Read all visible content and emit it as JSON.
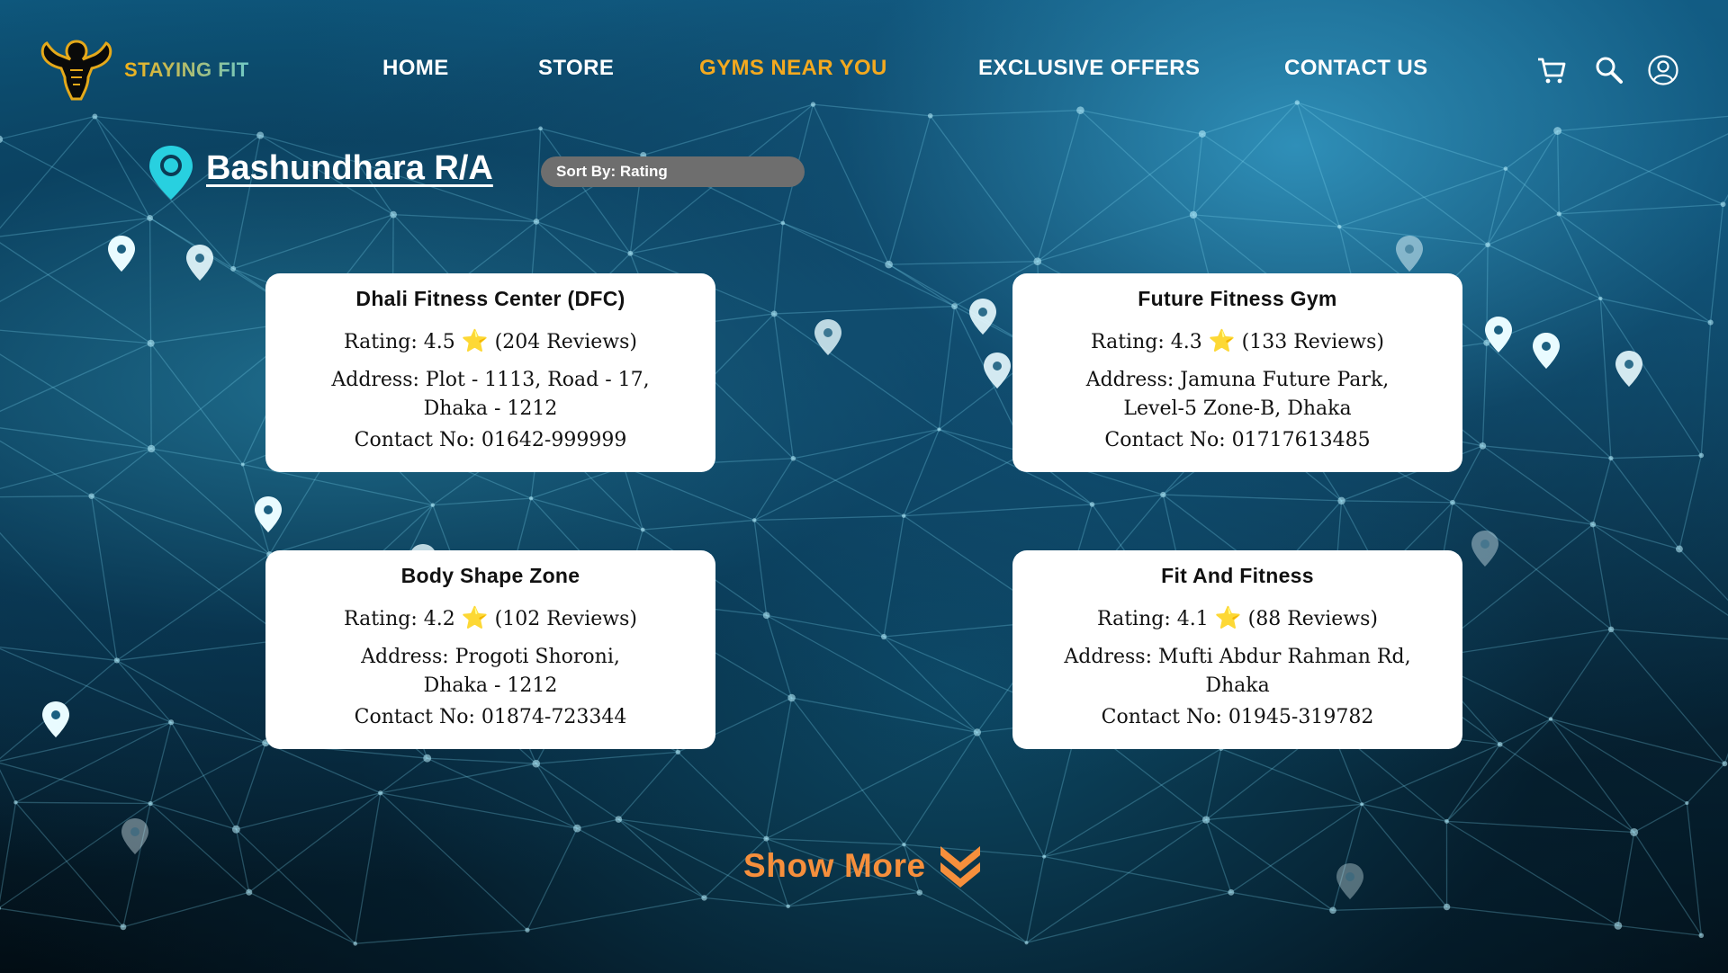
{
  "brand": {
    "name": "STAYING FIT"
  },
  "nav": {
    "items": [
      {
        "label": "HOME",
        "active": false
      },
      {
        "label": "STORE",
        "active": false
      },
      {
        "label": "GYMS NEAR YOU",
        "active": true
      },
      {
        "label": "EXCLUSIVE OFFERS",
        "active": false
      },
      {
        "label": "CONTACT US",
        "active": false
      }
    ],
    "icons": [
      "cart-icon",
      "search-icon",
      "user-icon"
    ]
  },
  "location": {
    "name": "Bashundhara R/A",
    "icon": "map-pin-icon"
  },
  "sort": {
    "label": "Sort By: Rating"
  },
  "gyms": [
    {
      "name": "Dhali Fitness Center (DFC)",
      "rating_text": "Rating: 4.5",
      "rating": 4.5,
      "star": "⭐",
      "reviews": "(204 Reviews)",
      "address_1": "Address: Plot - 1113, Road - 17,",
      "address_2": "Dhaka - 1212",
      "contact": "Contact No: 01642-999999"
    },
    {
      "name": "Future Fitness Gym",
      "rating_text": "Rating: 4.3",
      "rating": 4.3,
      "star": "⭐",
      "reviews": "(133 Reviews)",
      "address_1": "Address: Jamuna Future Park,",
      "address_2": "Level-5 Zone-B, Dhaka",
      "contact": "Contact No: 01717613485"
    },
    {
      "name": "Body Shape Zone",
      "rating_text": "Rating: 4.2",
      "rating": 4.2,
      "star": "⭐",
      "reviews": "(102 Reviews)",
      "address_1": "Address: Progoti Shoroni,",
      "address_2": "Dhaka - 1212",
      "contact": "Contact No: 01874-723344"
    },
    {
      "name": "Fit And Fitness",
      "rating_text": "Rating: 4.1",
      "rating": 4.1,
      "star": "⭐",
      "reviews": "(88 Reviews)",
      "address_1": "Address: Mufti Abdur Rahman Rd,",
      "address_2": "Dhaka",
      "contact": "Contact No: 01945-319782"
    }
  ],
  "show_more": {
    "label": "Show More",
    "icon": "double-chevron-down-icon"
  },
  "colors": {
    "accent": "#f3a91f",
    "show_more": "#f68f3c",
    "pin": "#28d0e0",
    "sort_bg": "#6e6e6e"
  }
}
